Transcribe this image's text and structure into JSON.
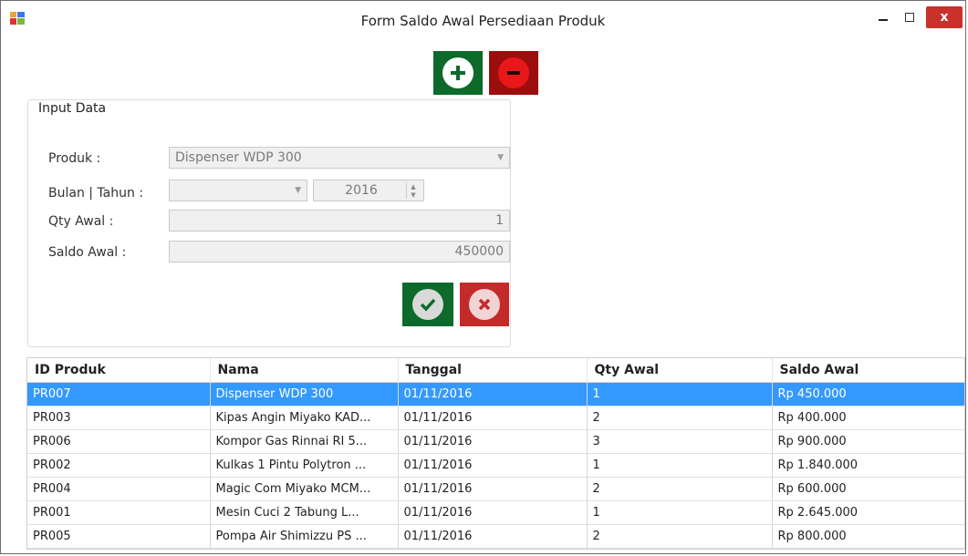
{
  "window": {
    "title": "Form Saldo Awal Persediaan Produk",
    "close_label": "x"
  },
  "input_group": {
    "legend": "Input Data",
    "produk_label": "Produk :",
    "produk_value": "Dispenser WDP 300",
    "bulan_tahun_label": "Bulan | Tahun :",
    "bulan_value": "",
    "tahun_value": "2016",
    "qty_label": "Qty Awal :",
    "qty_value": "1",
    "saldo_label": "Saldo Awal :",
    "saldo_value": "450000"
  },
  "grid": {
    "columns": [
      "ID Produk",
      "Nama",
      "Tanggal",
      "Qty Awal",
      "Saldo Awal"
    ],
    "rows": [
      {
        "id": "PR007",
        "nama": "Dispenser WDP 300",
        "tanggal": "01/11/2016",
        "qty": "1",
        "saldo": "Rp 450.000",
        "selected": true
      },
      {
        "id": "PR003",
        "nama": "Kipas Angin Miyako KAD...",
        "tanggal": "01/11/2016",
        "qty": "2",
        "saldo": "Rp 400.000",
        "selected": false
      },
      {
        "id": "PR006",
        "nama": "Kompor Gas Rinnai RI 5...",
        "tanggal": "01/11/2016",
        "qty": "3",
        "saldo": "Rp 900.000",
        "selected": false
      },
      {
        "id": "PR002",
        "nama": "Kulkas 1 Pintu Polytron ...",
        "tanggal": "01/11/2016",
        "qty": "1",
        "saldo": "Rp 1.840.000",
        "selected": false
      },
      {
        "id": "PR004",
        "nama": "Magic Com Miyako MCM...",
        "tanggal": "01/11/2016",
        "qty": "2",
        "saldo": "Rp 600.000",
        "selected": false
      },
      {
        "id": "PR001",
        "nama": "Mesin Cuci 2 Tabung L...",
        "tanggal": "01/11/2016",
        "qty": "1",
        "saldo": "Rp 2.645.000",
        "selected": false
      },
      {
        "id": "PR005",
        "nama": "Pompa Air Shimizzu PS ...",
        "tanggal": "01/11/2016",
        "qty": "2",
        "saldo": "Rp 800.000",
        "selected": false
      }
    ]
  },
  "colors": {
    "add_button": "#0d6a2a",
    "remove_button": "#9c0d0e",
    "ok_button": "#0d6a2a",
    "cancel_button": "#c42a2a",
    "selection": "#3399ff",
    "close_button": "#c9312b"
  },
  "icons": {
    "app": "app-icon",
    "add": "plus-circle-icon",
    "remove": "minus-circle-icon",
    "ok": "check-circle-icon",
    "cancel": "x-circle-icon"
  }
}
